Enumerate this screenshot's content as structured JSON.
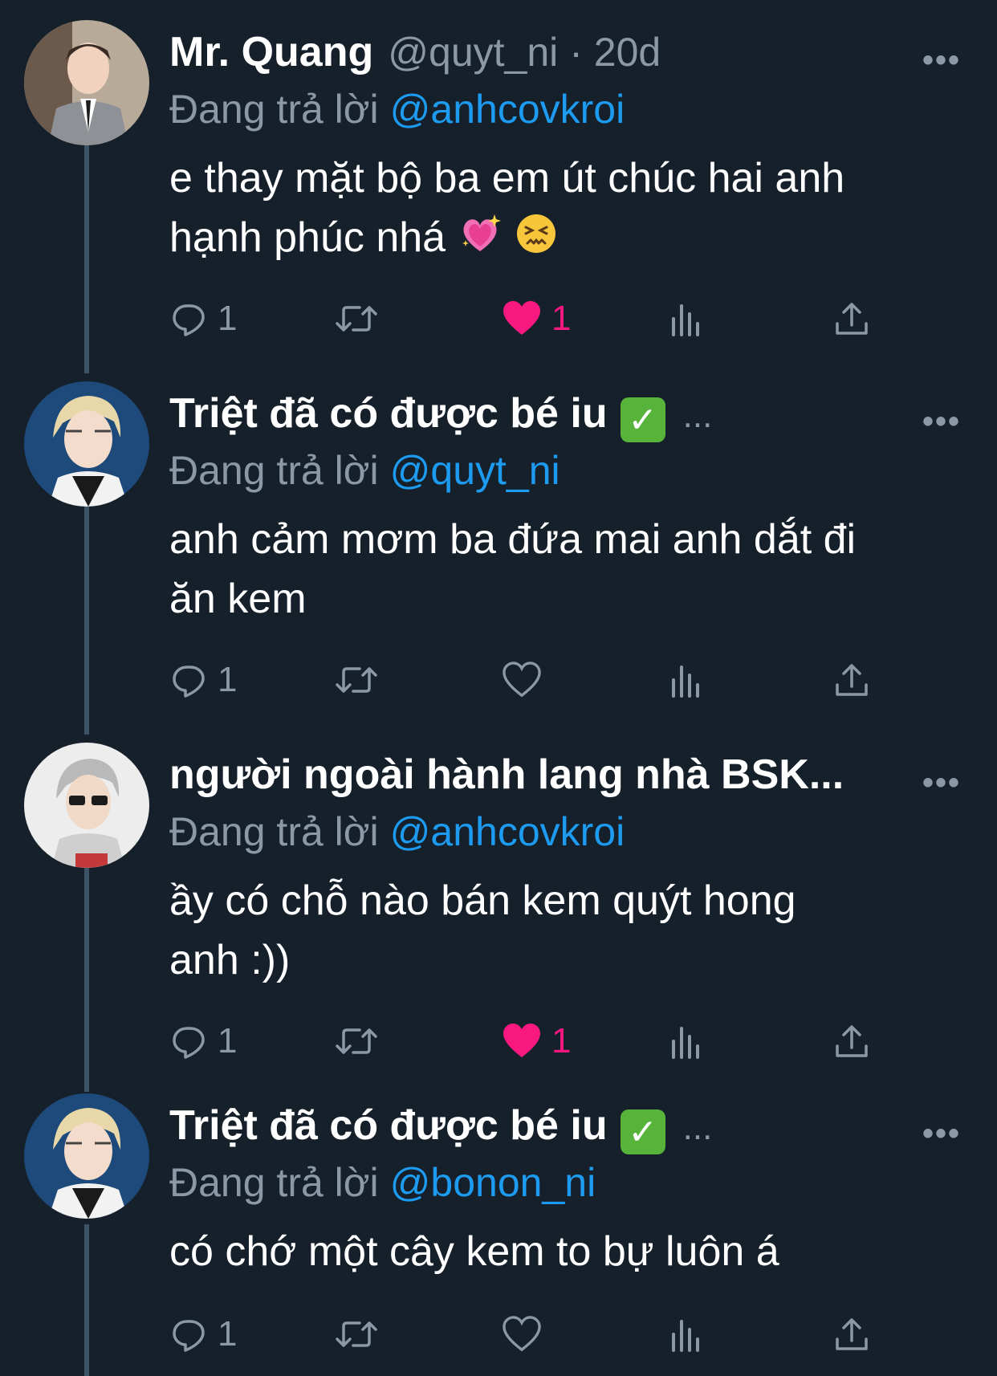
{
  "colors": {
    "background": "#15202b",
    "text_primary": "#ffffff",
    "text_secondary": "#8b98a5",
    "mention": "#1d9bf0",
    "like_active": "#f91880",
    "thread_line": "#3d5466"
  },
  "tweets": [
    {
      "display_name": "Mr. Quang",
      "handle": "@quyt_ni",
      "time": "· 20d",
      "reply_label": "Đang trả lời",
      "reply_to": "@anhcovkroi",
      "text_line1": "e thay mặt bộ ba em út chúc hai anh",
      "text_line2": "hạnh phúc nhá",
      "emojis": [
        "sparkling-heart-icon",
        "confounded-face-icon"
      ],
      "reply_count": "1",
      "retweet_count": "",
      "like_count": "1",
      "liked": true
    },
    {
      "display_name": "Triệt đã có được bé iu",
      "verified_icon": "check-mark-button-icon",
      "name_ellipsis": "...",
      "reply_label": "Đang trả lời",
      "reply_to": "@quyt_ni",
      "text_line1": "anh cảm mơm ba đứa mai anh dắt đi",
      "text_line2": "ăn kem",
      "reply_count": "1",
      "retweet_count": "",
      "like_count": "",
      "liked": false
    },
    {
      "display_name": "người ngoài hành lang nhà BSK...",
      "reply_label": "Đang trả lời",
      "reply_to": "@anhcovkroi",
      "text_line1": "ầy có chỗ nào bán kem quýt hong",
      "text_line2": "anh :))",
      "reply_count": "1",
      "retweet_count": "",
      "like_count": "1",
      "liked": true
    },
    {
      "display_name": "Triệt đã có được bé iu",
      "verified_icon": "check-mark-button-icon",
      "name_ellipsis": "...",
      "reply_label": "Đang trả lời",
      "reply_to": "@bonon_ni",
      "text_line1": "có chớ một cây kem to bự luôn á",
      "reply_count": "1",
      "retweet_count": "",
      "like_count": "",
      "liked": false
    }
  ],
  "more_label": "•••"
}
